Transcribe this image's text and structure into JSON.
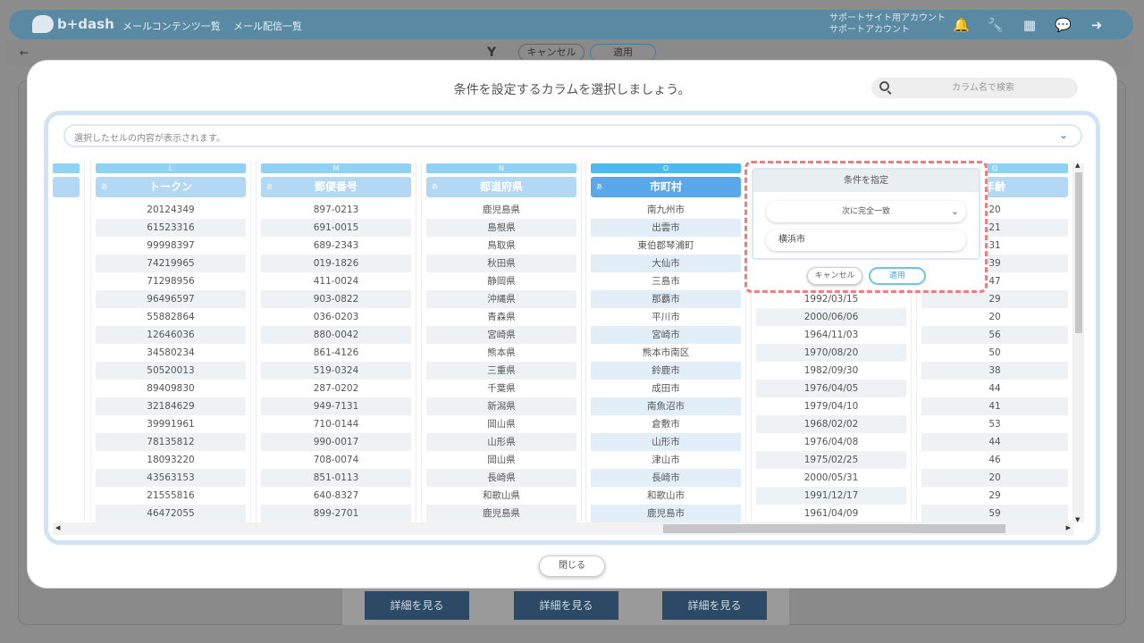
{
  "app": {
    "logo": "b+dash",
    "nav": [
      "メールコンテンツ一覧",
      "メール配信一覧"
    ],
    "account": [
      "サポートサイト用アカウント",
      "サポートアカウント"
    ],
    "icons": [
      "bell-icon",
      "wrench-icon",
      "apps-grid-icon",
      "chat-icon",
      "logout-icon"
    ]
  },
  "subbar": {
    "back": "←",
    "cancel": "キャンセル",
    "apply": "適用"
  },
  "background_buttons": [
    "詳細を見る",
    "詳細を見る",
    "詳細を見る"
  ],
  "modal": {
    "title": "条件を設定するカラムを選択しましょう。",
    "search_placeholder": "カラム名で検索",
    "cell_preview": "選択したセルの内容が表示されます。",
    "close": "閉じる"
  },
  "columns": [
    {
      "letter": "L",
      "type": "あ",
      "name": "トークン",
      "rows": [
        "20124349",
        "61523316",
        "99998397",
        "74219965",
        "71298956",
        "96496597",
        "55882864",
        "12646036",
        "34580234",
        "50520013",
        "89409830",
        "32184629",
        "39991961",
        "78135812",
        "18093220",
        "43563153",
        "21555816",
        "46472055"
      ]
    },
    {
      "letter": "M",
      "type": "あ",
      "name": "郵便番号",
      "rows": [
        "897-0213",
        "691-0015",
        "689-2343",
        "019-1826",
        "411-0024",
        "903-0822",
        "036-0203",
        "880-0042",
        "861-4126",
        "519-0324",
        "287-0202",
        "949-7131",
        "710-0144",
        "990-0017",
        "708-0074",
        "851-0113",
        "640-8327",
        "899-2701"
      ]
    },
    {
      "letter": "N",
      "type": "あ",
      "name": "都道府県",
      "rows": [
        "鹿児島県",
        "島根県",
        "鳥取県",
        "秋田県",
        "静岡県",
        "沖縄県",
        "青森県",
        "宮崎県",
        "熊本県",
        "三重県",
        "千葉県",
        "新潟県",
        "岡山県",
        "山形県",
        "岡山県",
        "長崎県",
        "和歌山県",
        "鹿児島県"
      ]
    },
    {
      "letter": "O",
      "type": "あ",
      "name": "市町村",
      "rows": [
        "南九州市",
        "出雲市",
        "東伯郡琴浦町",
        "大仙市",
        "三島市",
        "那覇市",
        "平川市",
        "宮崎市",
        "熊本市南区",
        "鈴鹿市",
        "成田市",
        "南魚沼市",
        "倉敷市",
        "山形市",
        "津山市",
        "長崎市",
        "和歌山市",
        "鹿児島市"
      ]
    },
    {
      "letter": "",
      "type": "",
      "name": "",
      "rows": [
        "",
        "",
        "",
        "",
        "",
        "",
        "1992/03/15",
        "2000/06/06",
        "1964/11/03",
        "1970/08/20",
        "1982/09/30",
        "1976/04/05",
        "1979/04/10",
        "1968/02/02",
        "1976/04/08",
        "1975/02/25",
        "2000/05/31",
        "1991/12/17",
        "1961/04/09"
      ]
    },
    {
      "letter": "Q",
      "type": "",
      "name": "年齢",
      "rows": [
        "20",
        "21",
        "31",
        "39",
        "47",
        "29",
        "20",
        "56",
        "50",
        "38",
        "44",
        "41",
        "53",
        "44",
        "46",
        "20",
        "29",
        "59"
      ]
    }
  ],
  "condition": {
    "title": "条件を指定",
    "operator": "次に完全一致",
    "value": "横浜市",
    "cancel": "キャンセル",
    "apply": "適用"
  }
}
